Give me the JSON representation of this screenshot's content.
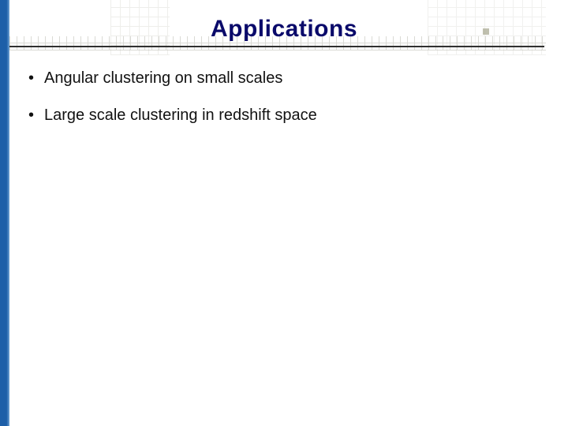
{
  "title": "Applications",
  "bullets": [
    "Angular clustering on small scales",
    "Large scale clustering in redshift space"
  ],
  "colors": {
    "title": "#0a0a6a",
    "spine": "#1d5fa8",
    "grid": "#b7b7ad"
  }
}
